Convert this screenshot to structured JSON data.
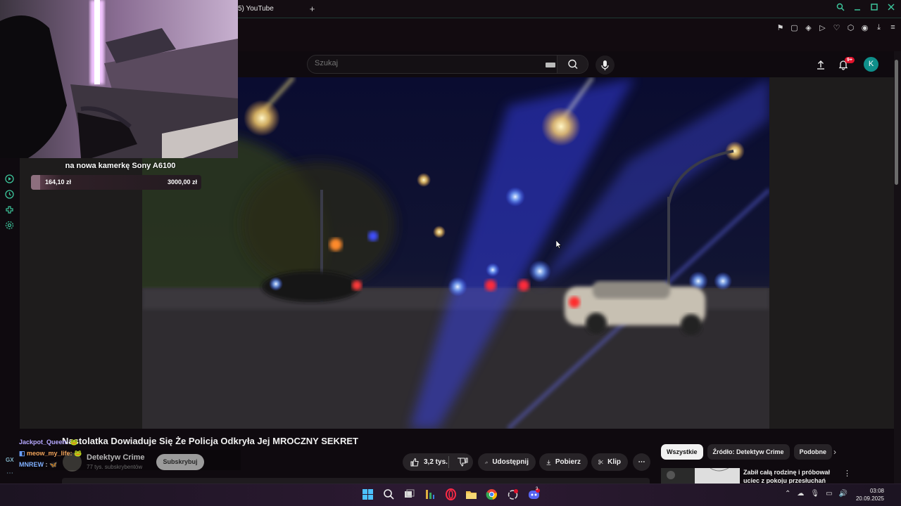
{
  "browser": {
    "tab_title": "5) YouTube",
    "new_tab": "+",
    "window_controls": [
      "search-icon",
      "minimize-icon",
      "maximize-icon",
      "close-icon"
    ]
  },
  "youtube": {
    "search_placeholder": "Szukaj",
    "notification_count": "9+",
    "avatar_letter": "K",
    "video_title": "Nastolatka Dowiaduje Się Że Policja Odkryła Jej MROCZNY SEKRET",
    "channel": {
      "name": "Detektyw Crime",
      "subscribers": "77 tys. subskrybentów"
    },
    "subscribe_label": "Subskrybuj",
    "actions": {
      "likes": "3,2 tys.",
      "share": "Udostępnij",
      "download": "Pobierz",
      "clip": "Klip",
      "more": "⋯"
    },
    "chips": [
      "Wszystkie",
      "Źródło: Detektyw Crime",
      "Podobne"
    ],
    "recommended": {
      "title": "Zabił całą rodzinę i próbował uciec z pokoju przesłuchań"
    }
  },
  "stream_overlay": {
    "goal_title": "na nowa kamerkę Sony A6100",
    "goal_current": "164,10 zł",
    "goal_target": "3000,00 zł",
    "goal_progress": 0.055,
    "chat": [
      {
        "user": "Jackpot_Queen",
        "color": "#b6a8ff"
      },
      {
        "user": "meow_my_life",
        "color": "#f0a35a"
      },
      {
        "user": "MNREW",
        "color": "#7fb0ff"
      }
    ],
    "chat_badge": "GX",
    "chat_more": "⋯"
  },
  "taskbar": {
    "time": "03:08",
    "date": "20.09.2025",
    "discord_badge": "3"
  },
  "colors": {
    "accent_green": "#3cc39a",
    "youtube_red": "#e0122b",
    "avatar_teal": "#0f8f8a"
  }
}
